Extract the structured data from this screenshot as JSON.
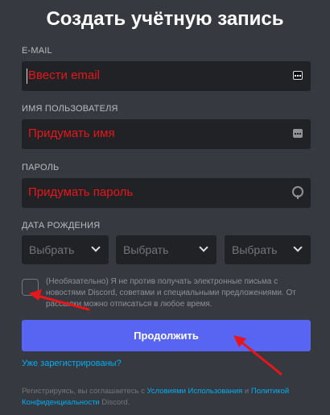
{
  "title": "Создать учётную запись",
  "email": {
    "label": "E-MAIL",
    "value": "Ввести email"
  },
  "username": {
    "label": "ИМЯ ПОЛЬЗОВАТЕЛЯ",
    "value": "Придумать имя"
  },
  "password": {
    "label": "ПАРОЛЬ",
    "value": "Придумать пароль"
  },
  "birthdate": {
    "label": "ДАТА РОЖДЕНИЯ",
    "month": "Выбрать",
    "day": "Выбрать",
    "year": "Выбрать"
  },
  "newsletter": {
    "text": "(Необязательно) Я не против получать электронные письма с новостями Discord, советами и специальными предложениями. От рассылки можно отписаться в любое время."
  },
  "continue_label": "Продолжить",
  "login_link": "Уже зарегистрированы?",
  "terms": {
    "prefix": "Регистрируясь, вы соглашаетесь с ",
    "tos_link": "Условиями Использования",
    "and": " и ",
    "privacy_link": "Политикой Конфиденциальности",
    "suffix": " Discord."
  },
  "colors": {
    "background": "#36393f",
    "input_bg": "#202225",
    "accent": "#5865f2",
    "link": "#00aff4",
    "annotation": "#e8161b"
  },
  "icons": {
    "email_field": "autofill-dots-icon",
    "username_field": "autofill-dots-icon",
    "password_field": "password-manager-key-icon",
    "select": "chevron-down-icon"
  }
}
